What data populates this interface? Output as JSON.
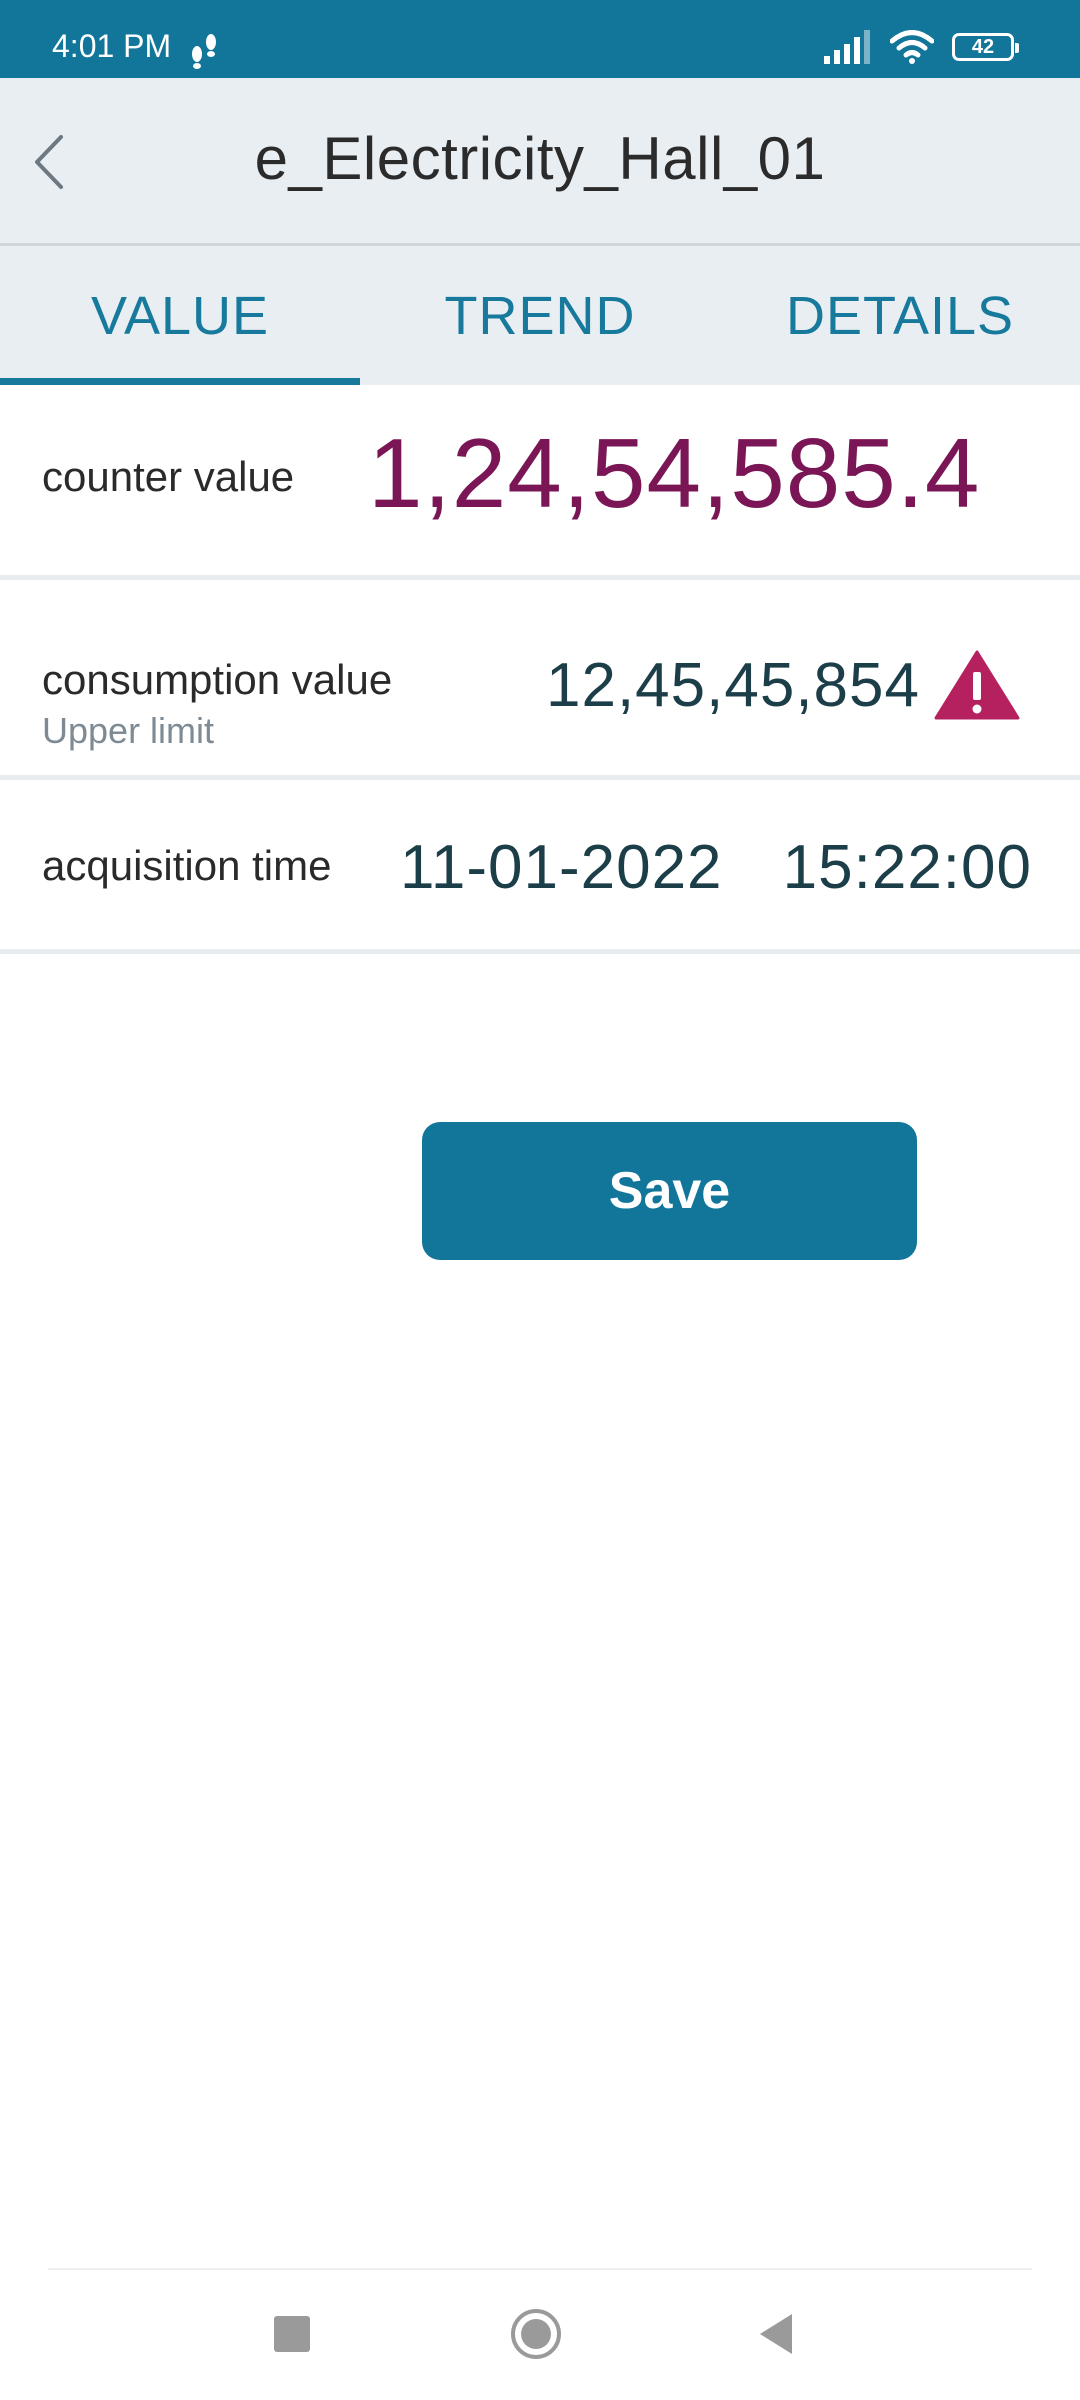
{
  "status_bar": {
    "time": "4:01 PM",
    "battery_level": "42",
    "icons": [
      "steps-icon",
      "signal-icon",
      "wifi-icon",
      "battery-icon"
    ]
  },
  "header": {
    "title": "e_Electricity_Hall_01",
    "back_icon": "chevron-left-icon"
  },
  "tabs": [
    {
      "label": "VALUE",
      "active": true
    },
    {
      "label": "TREND",
      "active": false
    },
    {
      "label": "DETAILS",
      "active": false
    }
  ],
  "counter": {
    "label": "counter value",
    "value": "1,24,54,585.4"
  },
  "consumption": {
    "label": "consumption value",
    "sublabel": "Upper limit",
    "value": "12,45,45,854",
    "status_icon": "warning-icon"
  },
  "acquisition": {
    "label": "acquisition time",
    "date": "11-01-2022",
    "time": "15:22:00"
  },
  "actions": {
    "save_label": "Save"
  },
  "colors": {
    "primary": "#11769a",
    "accent_value": "#7a1656",
    "warning": "#b5215f",
    "header_bg": "#e9eef2"
  }
}
